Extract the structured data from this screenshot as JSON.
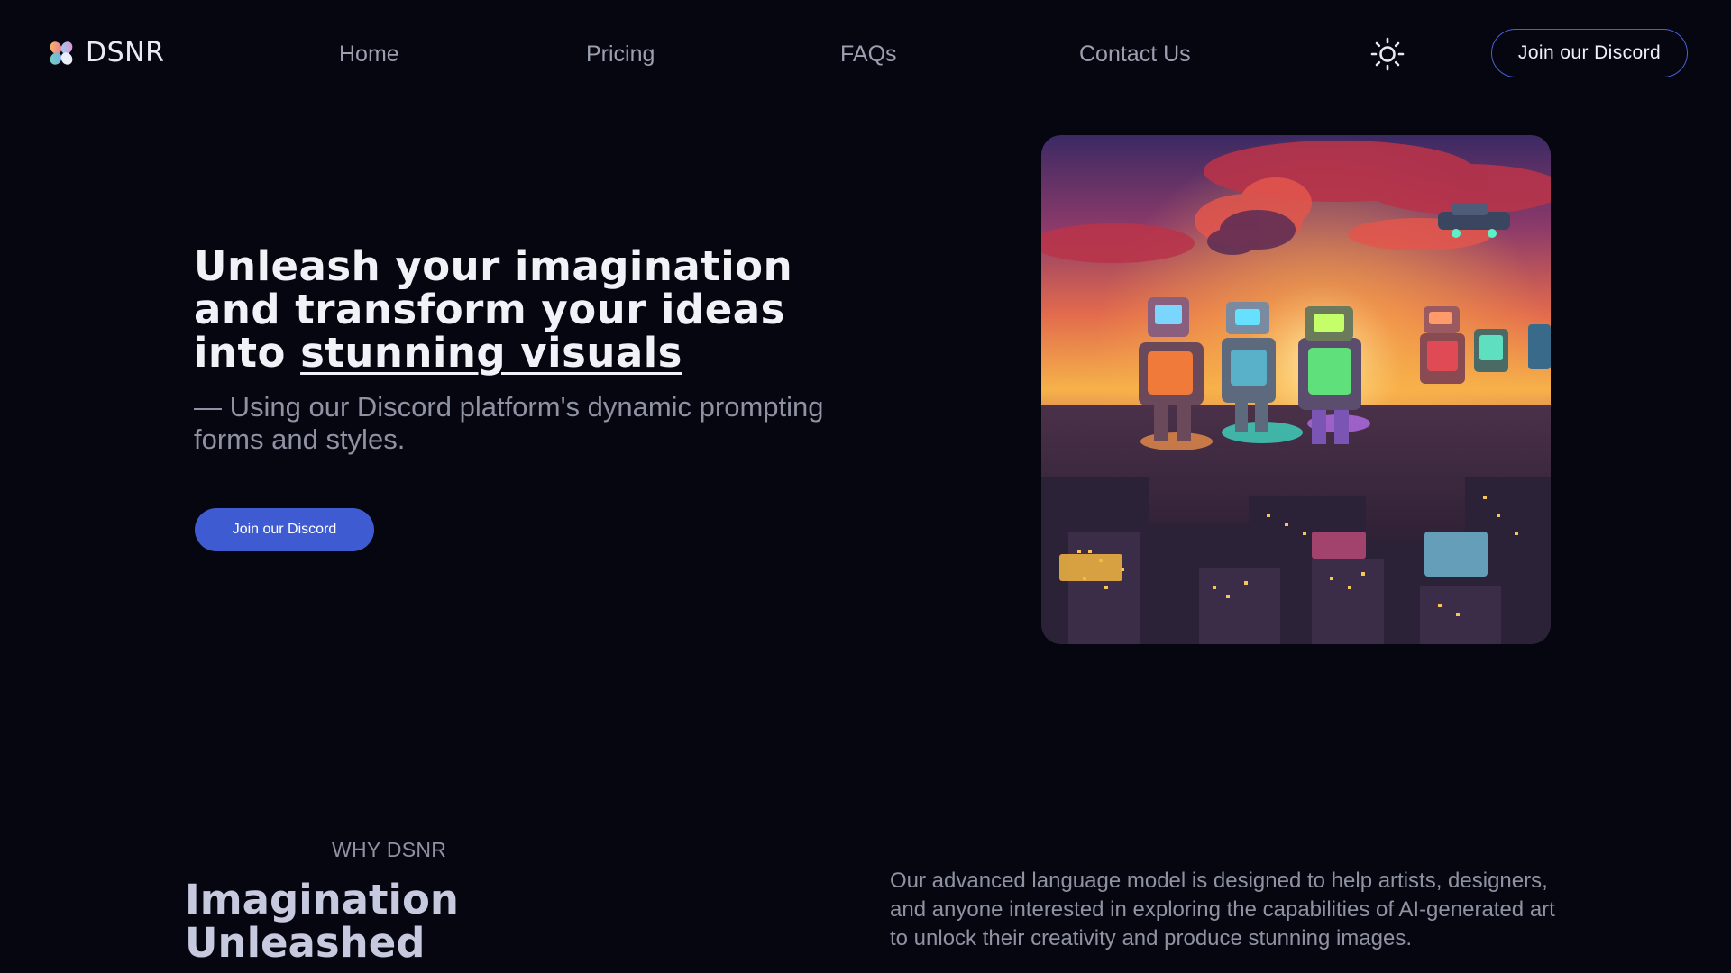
{
  "header": {
    "logo_text": "DSNR",
    "nav": [
      "Home",
      "Pricing",
      "FAQs",
      "Contact Us"
    ],
    "theme_icon": "sun-icon",
    "cta_label": "Join our Discord"
  },
  "hero": {
    "title_lines": [
      "Unleash your imagination",
      "and transform your ideas",
      "into "
    ],
    "title_emphasis": "stunning visuals",
    "subtitle": "— Using our Discord platform's dynamic prompting forms and styles.",
    "cta_label": "Join our Discord",
    "image_icon": "robot-city-illustration"
  },
  "why": {
    "eyebrow": "WHY DSNR",
    "title": "Imagination Unleashed",
    "body": "Our advanced language model is designed to help artists, designers, and anyone interested in exploring the capabilities of AI-generated art to unlock their creativity and produce stunning images."
  },
  "colors": {
    "background": "#05060f",
    "accent": "#3f5bd2",
    "muted_text": "#8e92a3"
  }
}
